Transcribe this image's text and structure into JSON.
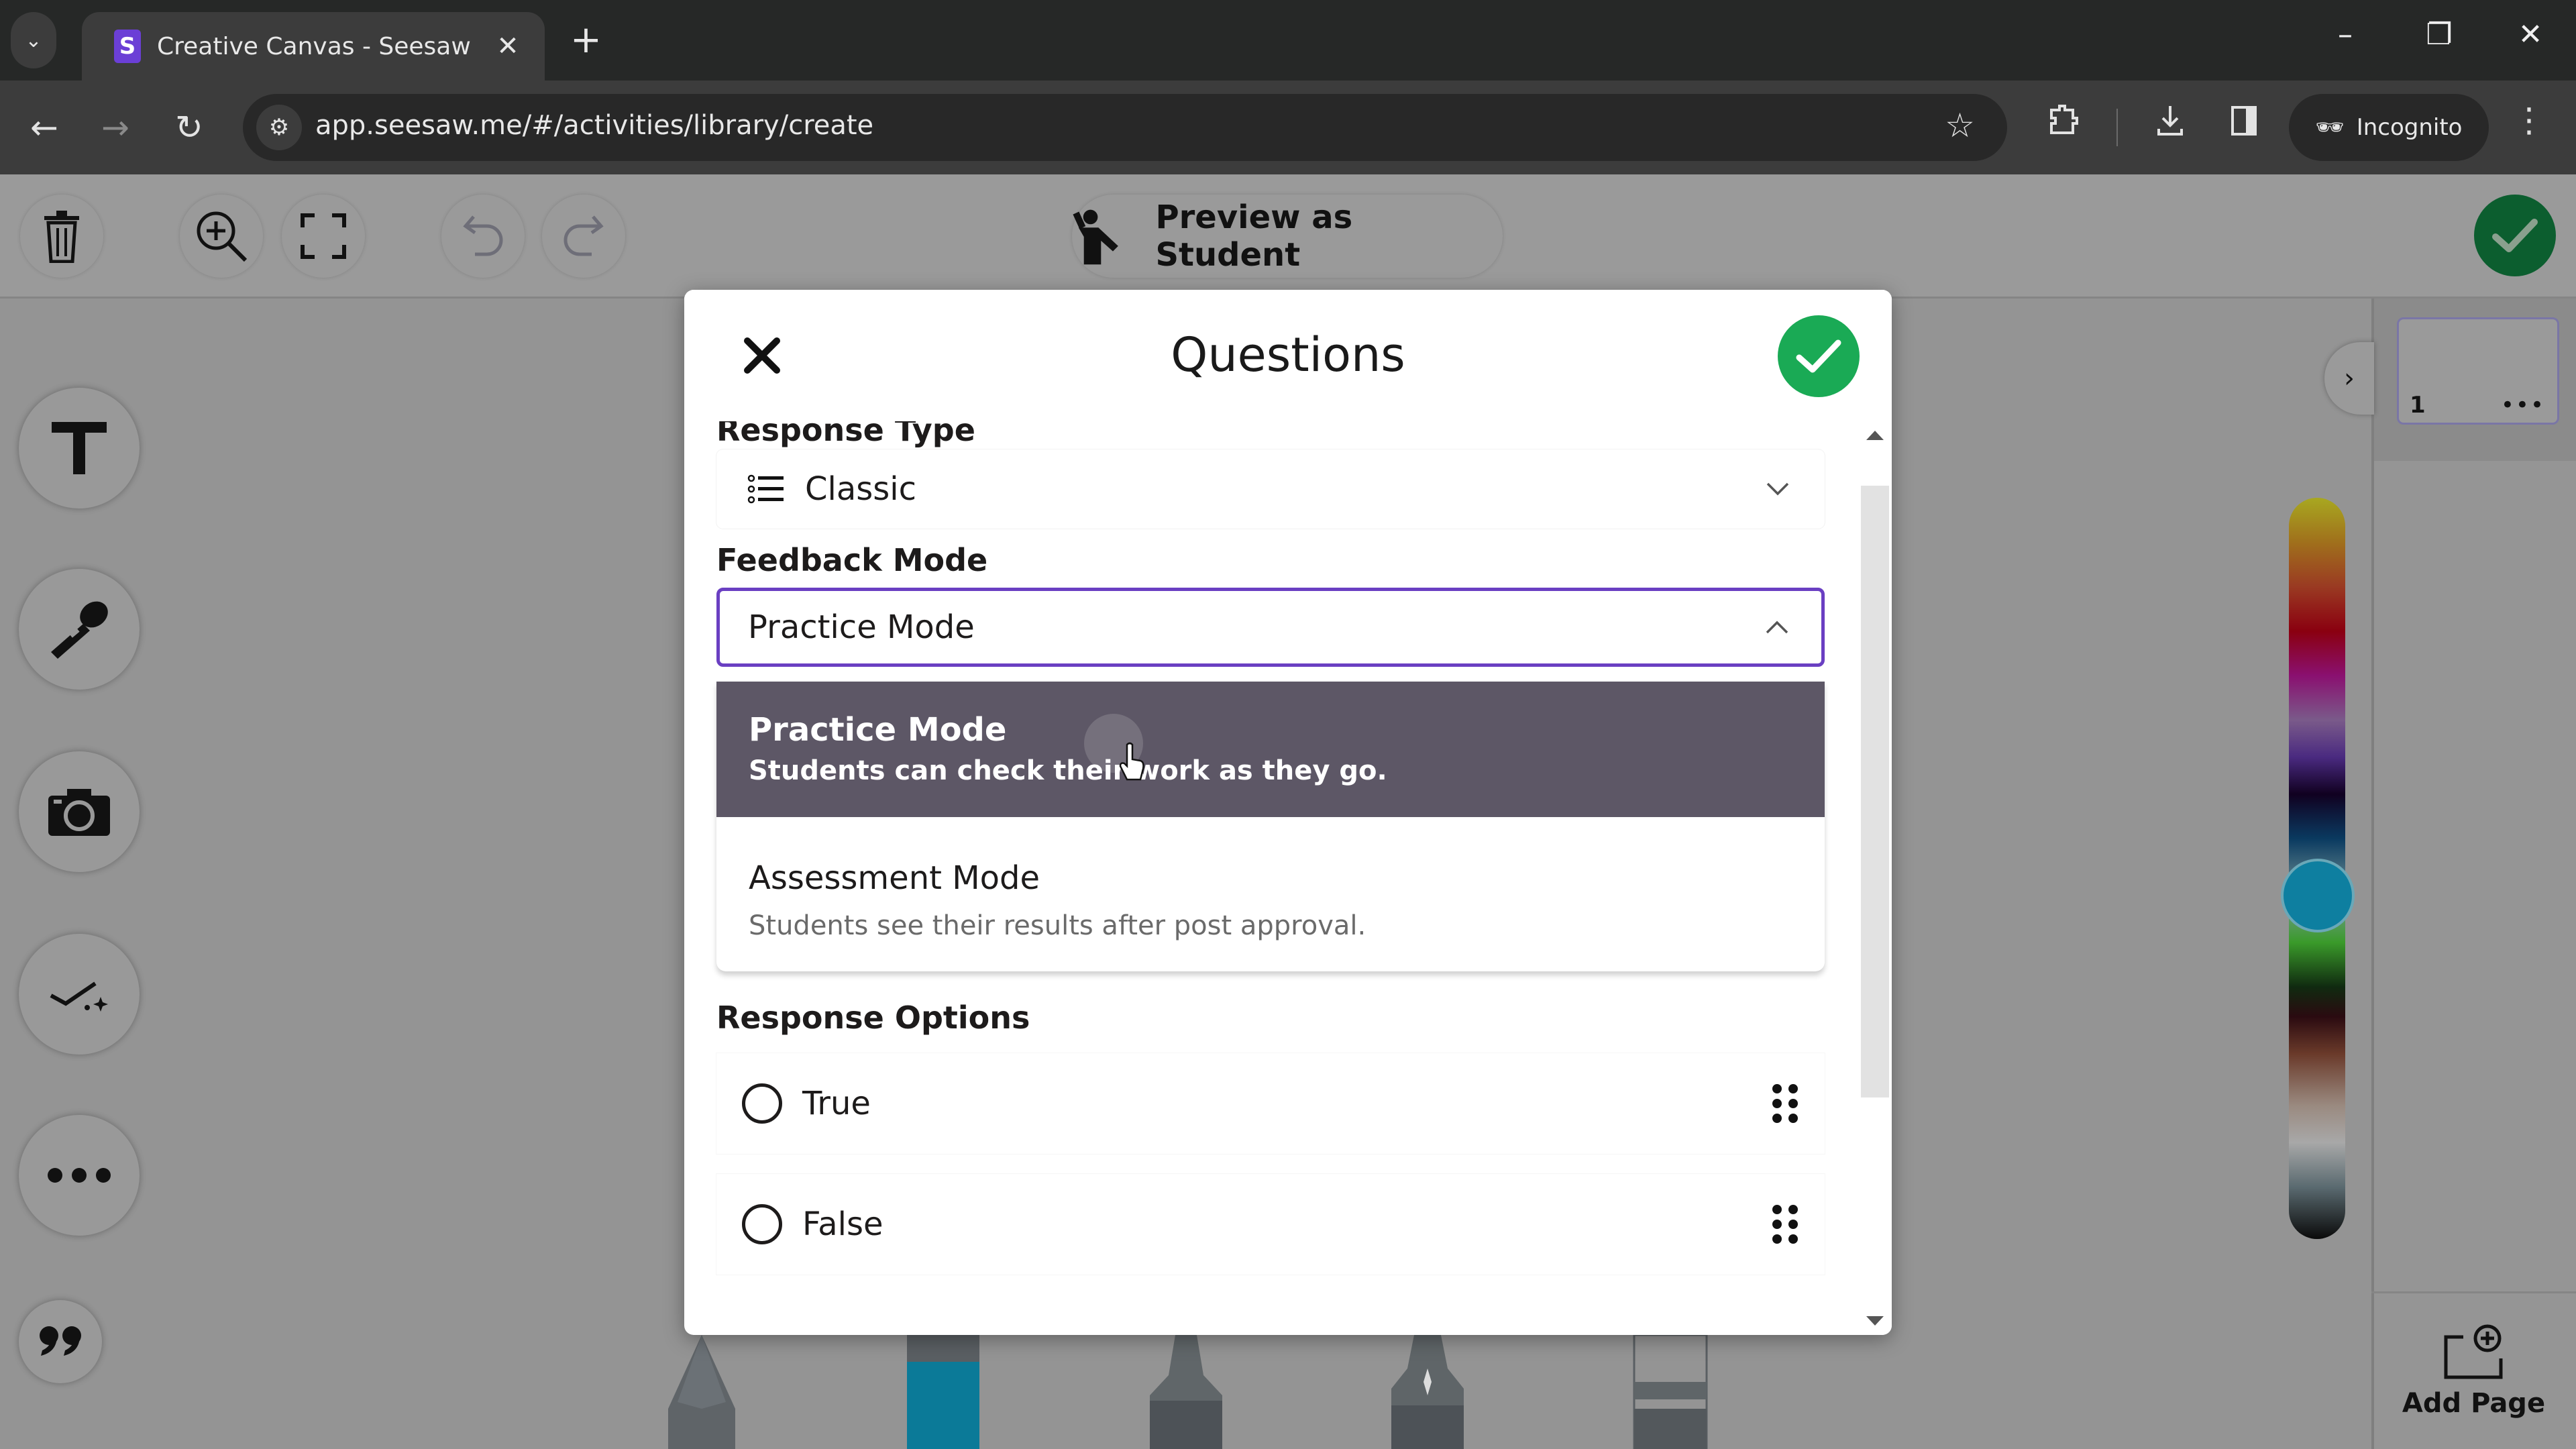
{
  "browser": {
    "tab": {
      "title": "Creative Canvas - Seesaw",
      "favicon_letter": "S"
    },
    "new_tab_label": "+",
    "url": "app.seesaw.me/#/activities/library/create",
    "incognito_label": "Incognito",
    "icons": {
      "tab_list": "chevron-down-icon",
      "back": "arrow-left-icon",
      "forward": "arrow-right-icon",
      "reload": "reload-icon",
      "site_info": "tune-icon",
      "bookmark": "star-icon",
      "extensions": "puzzle-icon",
      "downloads": "download-icon",
      "side_panel": "side-panel-icon",
      "menu": "kebab-menu-icon"
    },
    "window_controls": {
      "minimize": "–",
      "restore": "❐",
      "close": "✕"
    }
  },
  "app_toolbar": {
    "buttons": [
      "trash-icon",
      "zoom-in-icon",
      "fullscreen-icon",
      "undo-icon",
      "redo-icon"
    ],
    "preview_label": "Preview as Student",
    "done_icon": "check-icon"
  },
  "left_tools": [
    {
      "name": "text-tool",
      "icon": "text-icon"
    },
    {
      "name": "microphone-tool",
      "icon": "microphone-icon"
    },
    {
      "name": "camera-tool",
      "icon": "camera-icon"
    },
    {
      "name": "check-sparkle-tool",
      "icon": "check-sparkle-icon"
    },
    {
      "name": "more-tools",
      "icon": "more-horizontal-icon"
    },
    {
      "name": "quote-tool",
      "icon": "quote-icon"
    }
  ],
  "right_panel": {
    "collapse_icon": "chevron-right-icon",
    "pages": [
      {
        "number": "1",
        "more": "•••"
      }
    ],
    "add_page_label": "Add Page",
    "color_picker": {
      "selected_color": "#0e7fa0",
      "position_fraction": 0.5
    }
  },
  "drawing_tools": [
    "pencil",
    "marker",
    "crayon",
    "pen",
    "highlighter"
  ],
  "dialog": {
    "title": "Questions",
    "close_icon": "close-icon",
    "confirm_icon": "check-icon",
    "response_type": {
      "label": "Response Type",
      "value": "Classic",
      "icon": "list-icon"
    },
    "feedback_mode": {
      "label": "Feedback Mode",
      "value": "Practice Mode",
      "options": [
        {
          "title": "Practice Mode",
          "description": "Students can check their work as they go.",
          "selected": true
        },
        {
          "title": "Assessment Mode",
          "description": "Students see their results after post approval.",
          "selected": false
        }
      ]
    },
    "response_options": {
      "label": "Response Options",
      "items": [
        {
          "label": "True",
          "checked": false
        },
        {
          "label": "False",
          "checked": false
        }
      ]
    }
  },
  "colors": {
    "accent_purple": "#6a3fc2",
    "confirm_green": "#1aaa55",
    "done_green_dimmed": "#0c5e2f",
    "selected_option_bg": "#5d5766",
    "favicon_purple": "#6b3fd6"
  }
}
